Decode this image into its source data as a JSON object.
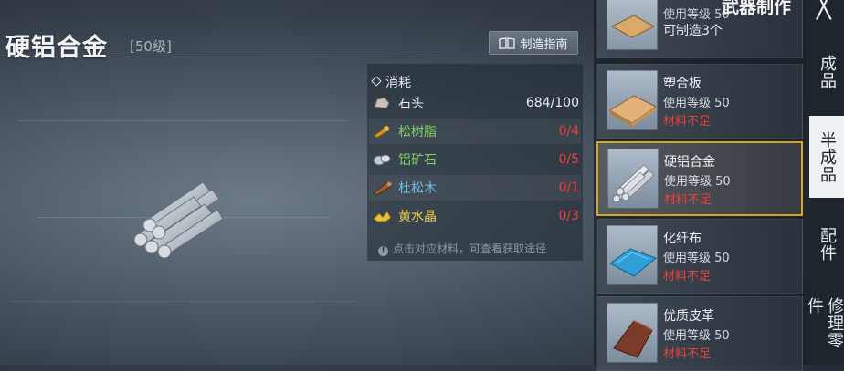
{
  "window": {
    "title": "武器制作",
    "close_label": "╳"
  },
  "item": {
    "name": "硬铝合金",
    "level": "[50级]",
    "guide_label": "制造指南"
  },
  "materials": {
    "header": "消耗",
    "rows": [
      {
        "name": "石头",
        "count": "684/100",
        "color": "white",
        "icon": "stone-icon"
      },
      {
        "name": "松树脂",
        "count": "0/4",
        "color": "green",
        "icon": "resin-icon"
      },
      {
        "name": "铝矿石",
        "count": "0/5",
        "color": "green",
        "icon": "aluminum-ore-icon"
      },
      {
        "name": "杜松木",
        "count": "0/1",
        "color": "blue",
        "icon": "juniper-wood-icon"
      },
      {
        "name": "黄水晶",
        "count": "0/3",
        "color": "yellow",
        "icon": "citrine-icon"
      }
    ],
    "hint": "点击对应材料，可查看获取途径"
  },
  "recipes": [
    {
      "name": "",
      "level": "使用等级 50",
      "status": "可制造3个",
      "status_type": "ok"
    },
    {
      "name": "塑合板",
      "level": "使用等级 50",
      "status": "材料不足",
      "status_type": "short"
    },
    {
      "name": "硬铝合金",
      "level": "使用等级 50",
      "status": "材料不足",
      "status_type": "short"
    },
    {
      "name": "化纤布",
      "level": "使用等级 50",
      "status": "材料不足",
      "status_type": "short"
    },
    {
      "name": "优质皮革",
      "level": "使用等级 50",
      "status": "材料不足",
      "status_type": "short"
    }
  ],
  "tabs": [
    "成品",
    "半成品",
    "配件",
    "修理零件"
  ],
  "colors": {
    "selected_border": "#d9a32a",
    "shortage": "#e8403a",
    "green": "#7fd06a",
    "blue": "#6cc1ea",
    "yellow": "#f0d04a"
  }
}
